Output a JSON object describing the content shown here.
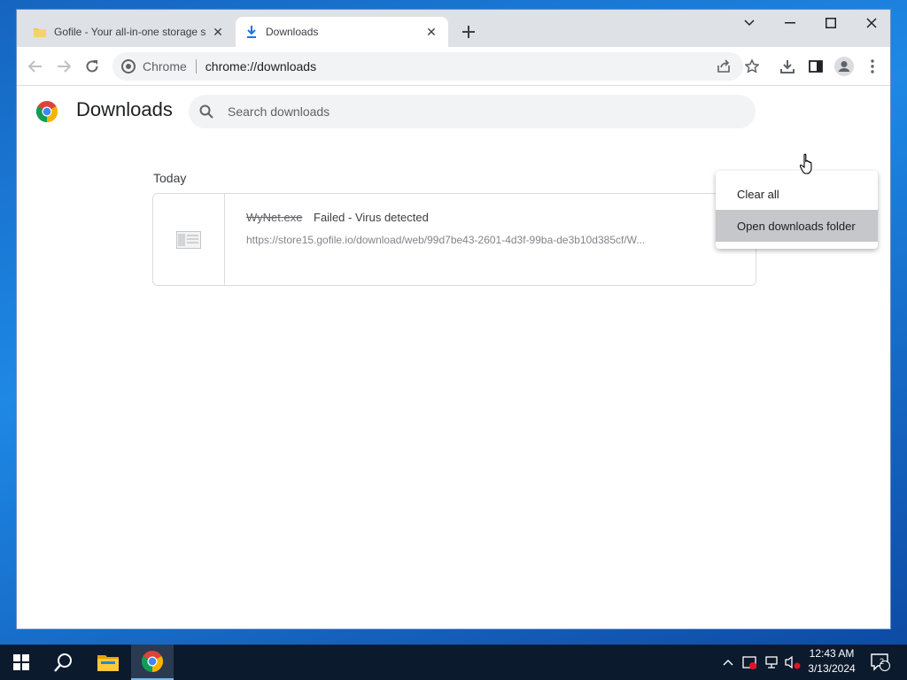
{
  "tabs": [
    {
      "title": "Gofile - Your all-in-one storage s",
      "icon": "folder-icon"
    },
    {
      "title": "Downloads",
      "icon": "download-icon"
    }
  ],
  "omnibox": {
    "chip": "Chrome",
    "url": "chrome://downloads"
  },
  "page": {
    "title": "Downloads",
    "search_placeholder": "Search downloads",
    "section": "Today"
  },
  "download": {
    "filename": "WyNet.exe",
    "status": "Failed - Virus detected",
    "url": "https://store15.gofile.io/download/web/99d7be43-2601-4d3f-99ba-de3b10d385cf/W..."
  },
  "menu": {
    "items": [
      "Clear all",
      "Open downloads folder"
    ],
    "hovered": "Open downloads folder"
  },
  "taskbar": {
    "time": "12:43 AM",
    "date": "3/13/2024",
    "notifications": "2"
  },
  "colors": {
    "accent": "#1a73e8",
    "tabstrip": "#dee1e6",
    "taskbar": "#0c1a2d",
    "menu_hover": "#c5c7ca"
  }
}
